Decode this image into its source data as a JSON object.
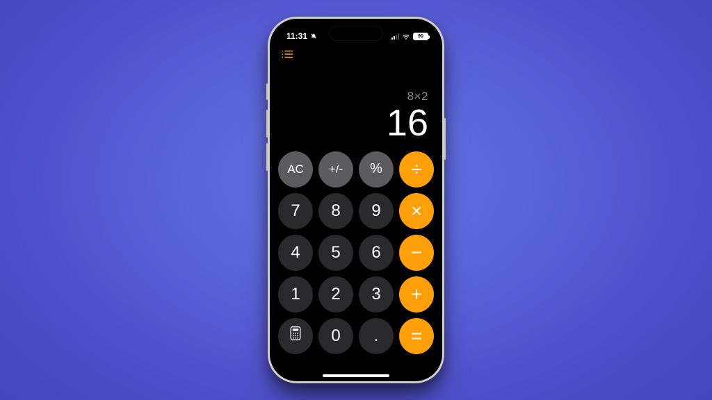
{
  "status": {
    "time": "11:31",
    "battery": "90"
  },
  "calc": {
    "expression": "8×2",
    "result": "16",
    "keys": {
      "ac": "AC",
      "sign": "+/-",
      "percent": "%",
      "divide": "÷",
      "seven": "7",
      "eight": "8",
      "nine": "9",
      "multiply": "×",
      "four": "4",
      "five": "5",
      "six": "6",
      "minus": "−",
      "one": "1",
      "two": "2",
      "three": "3",
      "plus": "+",
      "zero": "0",
      "decimal": ".",
      "equals": "="
    }
  },
  "colors": {
    "accent": "#ff9f0a",
    "func": "#5c5c5f",
    "num": "#2a2a2c"
  }
}
